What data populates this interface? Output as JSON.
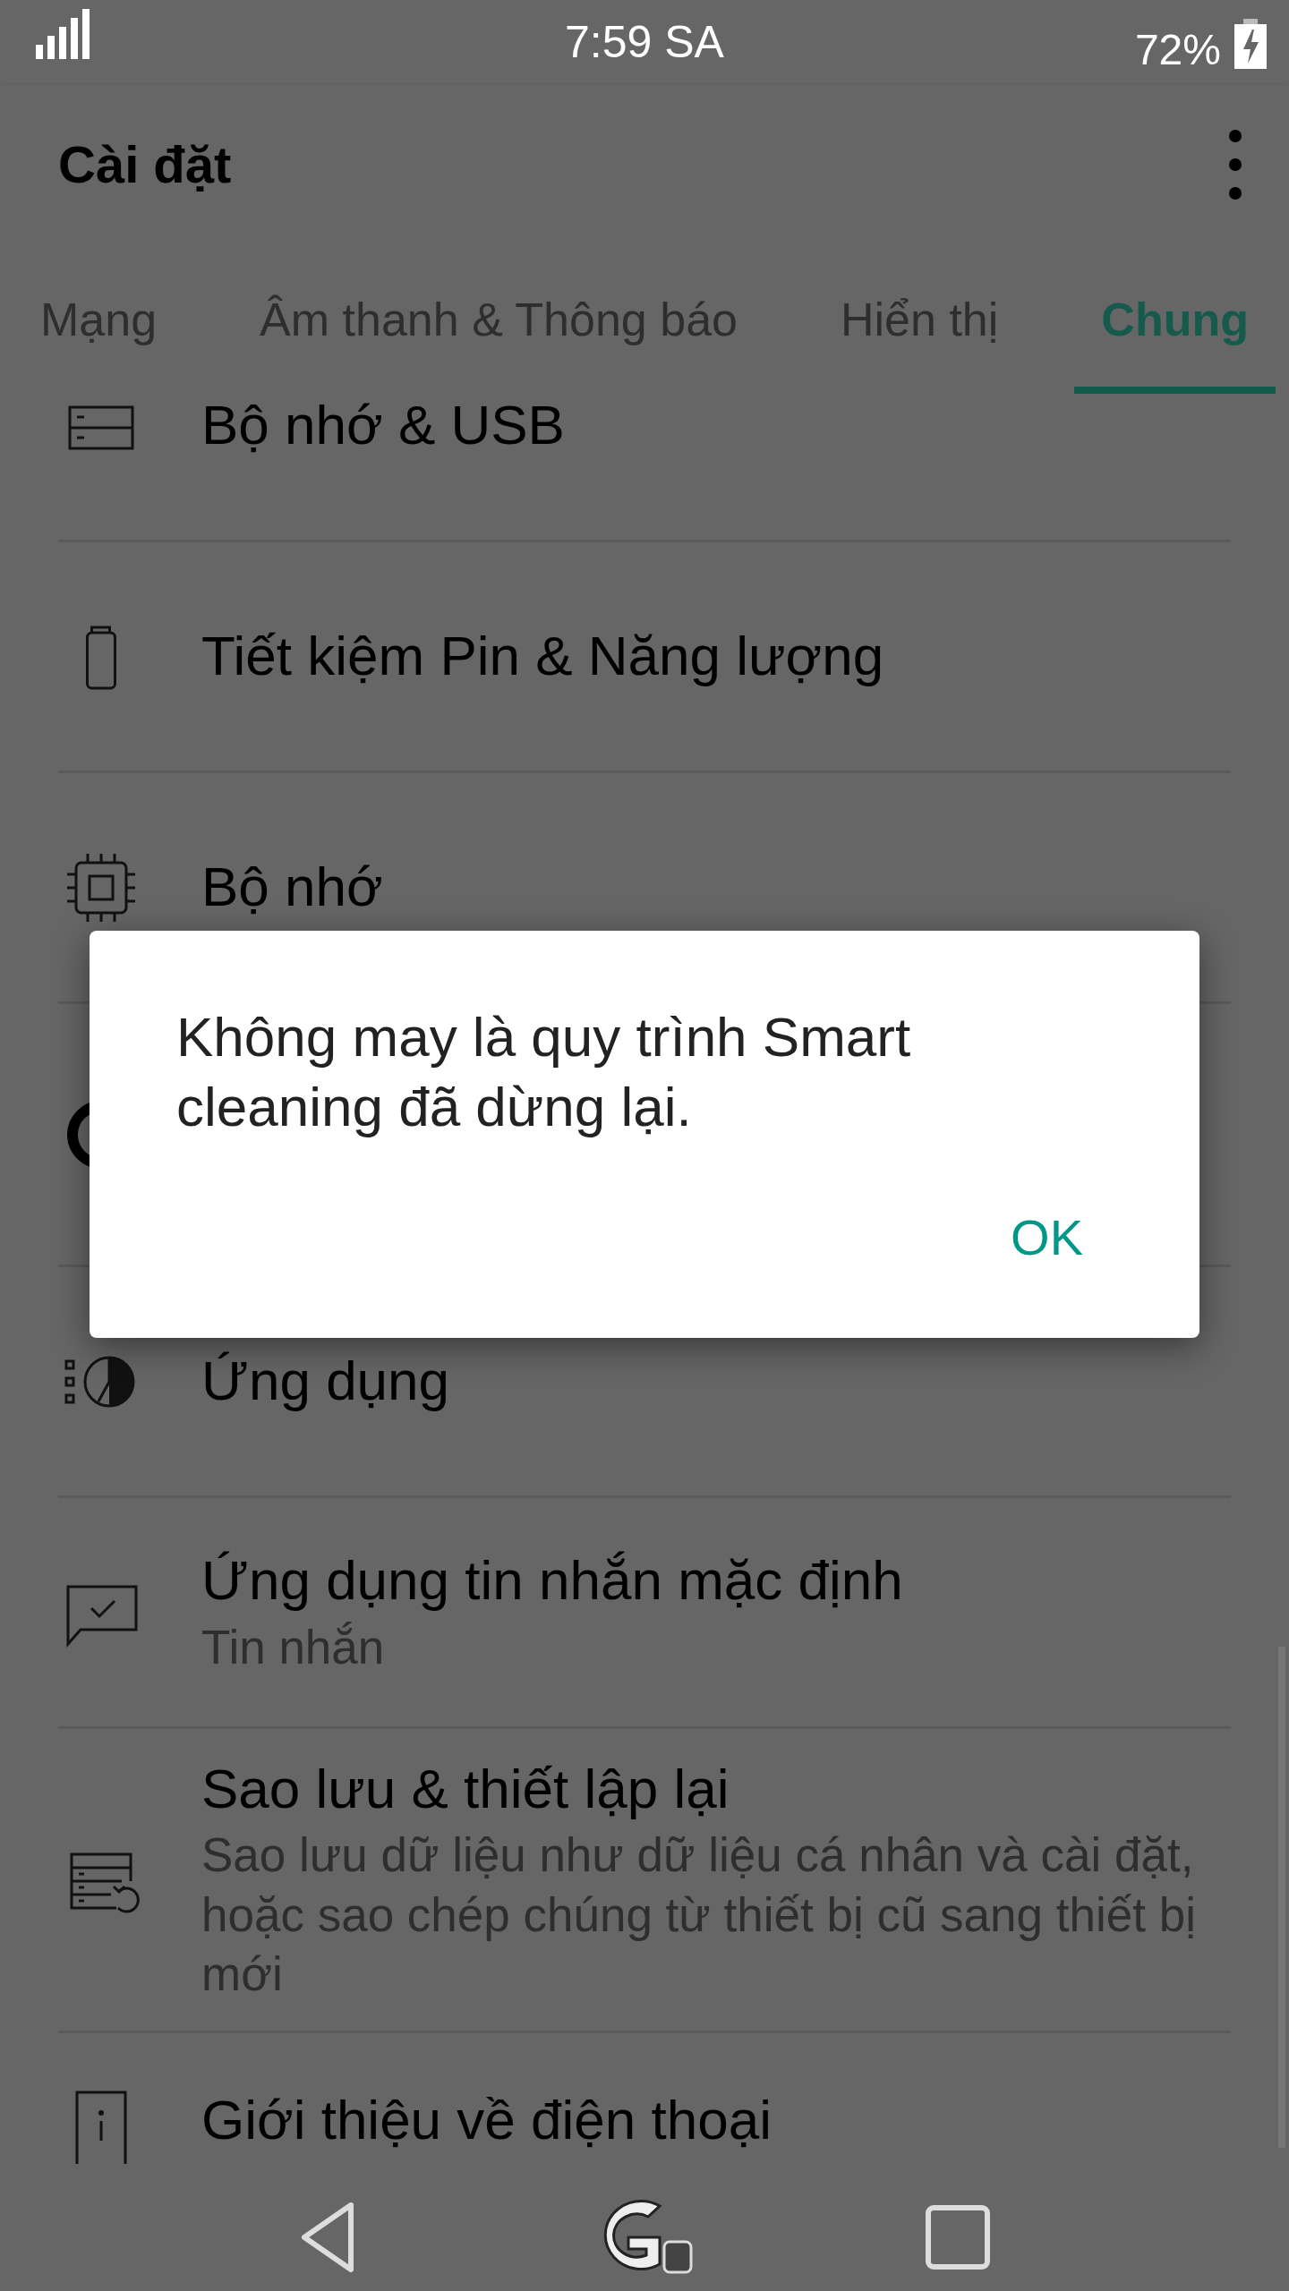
{
  "status_bar": {
    "time": "7:59 SA",
    "battery": "72%"
  },
  "app_bar": {
    "title": "Cài đặt"
  },
  "tabs": [
    {
      "label": "Mạng",
      "selected": false
    },
    {
      "label": "Âm thanh & Thông báo",
      "selected": false
    },
    {
      "label": "Hiển thị",
      "selected": false
    },
    {
      "label": "Chung",
      "selected": true
    }
  ],
  "items": [
    {
      "kind": "storage",
      "title": "Bộ nhớ & USB"
    },
    {
      "kind": "battery",
      "title": "Tiết kiệm Pin & Năng lượng"
    },
    {
      "kind": "memory",
      "title": "Bộ nhớ"
    },
    {
      "kind": "covered"
    },
    {
      "kind": "apps",
      "title": "Ứng dụng"
    },
    {
      "kind": "message",
      "title": "Ứng dụng tin nhắn mặc định",
      "subtitle": "Tin nhắn"
    },
    {
      "kind": "backup",
      "title": "Sao lưu & thiết lập lại",
      "subtitle": "Sao lưu dữ liệu như dữ liệu cá nhân và cài đặt, hoặc sao chép chúng từ thiết bị cũ sang thiết bị mới"
    },
    {
      "kind": "info",
      "title": "Giới thiệu về điện thoại"
    }
  ],
  "dialog": {
    "message": "Không may là quy trình Smart cleaning đã dừng lại.",
    "button": "OK"
  }
}
